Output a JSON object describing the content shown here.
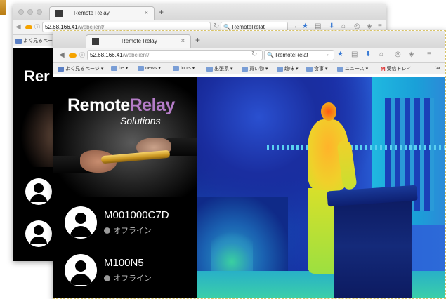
{
  "back_window": {
    "tab_title": "Remote Relay",
    "url_host": "52.68.166.41",
    "url_path": "/webclient/",
    "search_text": "RemoteRelat",
    "bookmark_first": "よく見るページ",
    "sidebar_title": "Rer"
  },
  "front_window": {
    "tab_title": "Remote Relay",
    "url_host": "52.68.166.41",
    "url_path": "/webclient/",
    "search_text": "RemoteRelat",
    "bookmarks": [
      {
        "label": "よく見るページ",
        "icon": "grid-icon"
      },
      {
        "label": "be",
        "icon": "folder-icon"
      },
      {
        "label": "news",
        "icon": "folder-icon"
      },
      {
        "label": "tools",
        "icon": "folder-icon"
      },
      {
        "label": "出張系",
        "icon": "folder-icon"
      },
      {
        "label": "買い物",
        "icon": "folder-icon"
      },
      {
        "label": "趣味",
        "icon": "folder-icon"
      },
      {
        "label": "食事",
        "icon": "folder-icon"
      },
      {
        "label": "ニュース",
        "icon": "folder-icon"
      },
      {
        "label": "受信トレイ",
        "icon": "gmail-icon"
      }
    ],
    "bookmark_overflow": "≫"
  },
  "app": {
    "logo_word1": "Remote",
    "logo_word2": "Relay",
    "logo_subtitle": "Solutions",
    "clients": [
      {
        "name": "M001000C7D",
        "status": "オフライン"
      },
      {
        "name": "M100N5",
        "status": "オフライン"
      }
    ]
  },
  "colors": {
    "accent_purple": "#b47cc7",
    "sidebar_bg": "#000000",
    "status_offline": "#9a9a9a"
  }
}
